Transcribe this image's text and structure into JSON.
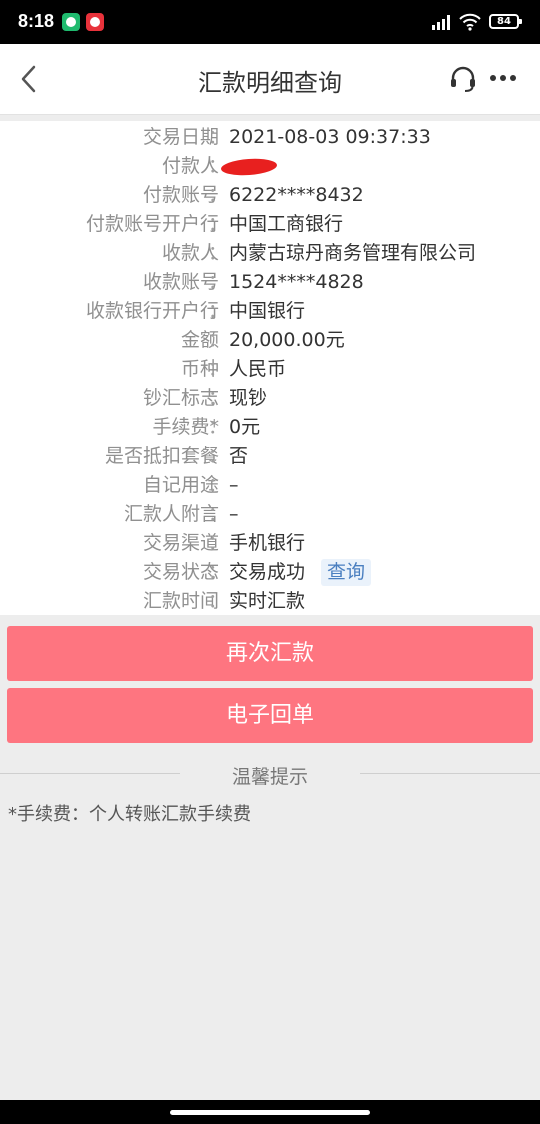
{
  "status_bar": {
    "time": "8:18",
    "battery": "84",
    "icons": [
      "shield-app-icon",
      "red-app-icon",
      "signal-icon",
      "wifi-icon",
      "battery-icon"
    ]
  },
  "header": {
    "title": "汇款明细查询",
    "icons": [
      "back-icon",
      "headset-icon",
      "more-icon"
    ]
  },
  "details": [
    {
      "label": "交易日期",
      "value": "2021-08-03 09:37:33"
    },
    {
      "label": "付款人",
      "value": ""
    },
    {
      "label": "付款账号",
      "value": "6222****8432"
    },
    {
      "label": "付款账号开户行",
      "value": "中国工商银行"
    },
    {
      "label": "收款人",
      "value": "内蒙古琼丹商务管理有限公司"
    },
    {
      "label": "收款账号",
      "value": "1524****4828"
    },
    {
      "label": "收款银行开户行",
      "value": "中国银行"
    },
    {
      "label": "金额",
      "value": "20,000.00元"
    },
    {
      "label": "币种",
      "value": "人民币"
    },
    {
      "label": "钞汇标志",
      "value": "现钞"
    },
    {
      "label": "手续费*",
      "value": "0元"
    },
    {
      "label": "是否抵扣套餐",
      "value": "否"
    },
    {
      "label": "自记用途",
      "value": "–"
    },
    {
      "label": "汇款人附言",
      "value": "–"
    },
    {
      "label": "交易渠道",
      "value": "手机银行"
    },
    {
      "label": "交易状态",
      "value": "交易成功",
      "action": "查询"
    },
    {
      "label": "汇款时间",
      "value": "实时汇款"
    }
  ],
  "colon": "：",
  "buttons": {
    "remit_again": "再次汇款",
    "e_receipt": "电子回单"
  },
  "tips": {
    "title": "温馨提示",
    "text": "*手续费：个人转账汇款手续费"
  },
  "colors": {
    "button": "#fe7580",
    "link": "#4a7fc0",
    "label": "#909090"
  }
}
